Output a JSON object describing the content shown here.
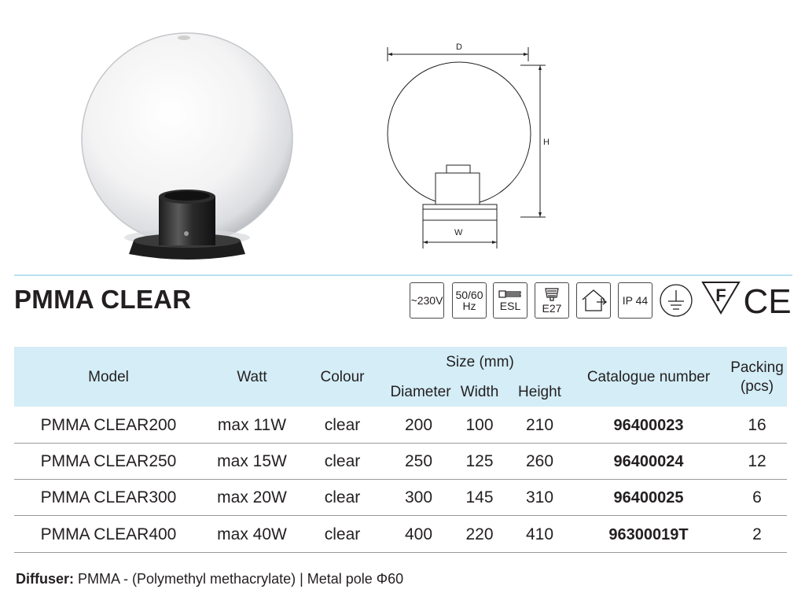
{
  "drawing": {
    "label_d": "D",
    "label_h": "H",
    "label_w": "W"
  },
  "product": {
    "title": "PMMA CLEAR"
  },
  "certifications": [
    {
      "name": "voltage",
      "lines": [
        "~230V"
      ]
    },
    {
      "name": "frequency",
      "lines": [
        "50/60",
        "Hz"
      ]
    },
    {
      "name": "esl",
      "lines": [
        "ESL"
      ]
    },
    {
      "name": "socket",
      "lines": [
        "E27"
      ]
    },
    {
      "name": "indoor-outdoor",
      "lines": []
    },
    {
      "name": "ip",
      "lines": [
        "IP 44"
      ]
    },
    {
      "name": "earth",
      "lines": []
    },
    {
      "name": "f-mark",
      "lines": [
        "F"
      ]
    },
    {
      "name": "ce-mark",
      "lines": [
        "CE"
      ]
    }
  ],
  "table": {
    "headers": {
      "model": "Model",
      "watt": "Watt",
      "colour": "Colour",
      "size": "Size (mm)",
      "diameter": "Diameter",
      "width": "Width",
      "height": "Height",
      "catalogue": "Catalogue number",
      "packing": "Packing",
      "packing_unit": "(pcs)"
    },
    "rows": [
      {
        "model": "PMMA CLEAR200",
        "watt": "max 11W",
        "colour": "clear",
        "diameter": "200",
        "width": "100",
        "height": "210",
        "catalogue": "96400023",
        "packing": "16"
      },
      {
        "model": "PMMA CLEAR250",
        "watt": "max 15W",
        "colour": "clear",
        "diameter": "250",
        "width": "125",
        "height": "260",
        "catalogue": "96400024",
        "packing": "12"
      },
      {
        "model": "PMMA CLEAR300",
        "watt": "max 20W",
        "colour": "clear",
        "diameter": "300",
        "width": "145",
        "height": "310",
        "catalogue": "96400025",
        "packing": "6"
      },
      {
        "model": "PMMA CLEAR400",
        "watt": "max 40W",
        "colour": "clear",
        "diameter": "400",
        "width": "220",
        "height": "410",
        "catalogue": "96300019T",
        "packing": "2"
      }
    ]
  },
  "footer": {
    "label": "Diffuser:",
    "text": " PMMA - (Polymethyl methacrylate) | Metal pole Φ60"
  }
}
